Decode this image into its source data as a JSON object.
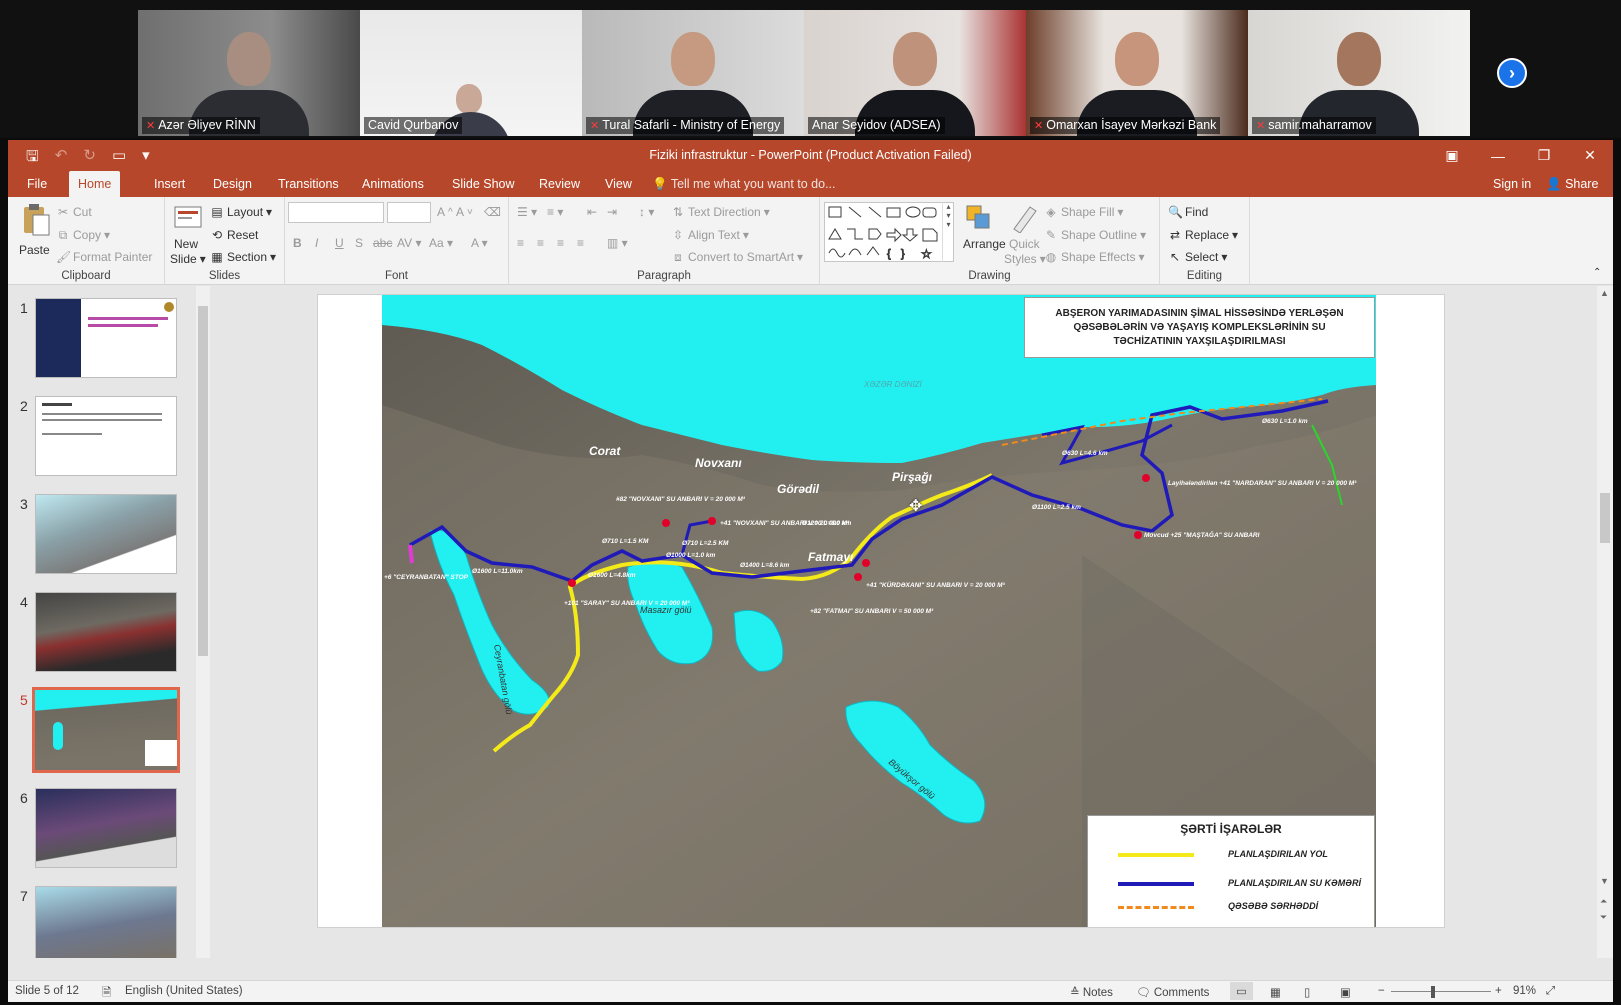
{
  "meeting": {
    "participants": [
      {
        "name": "Azər Əliyev RİNN",
        "muted": true
      },
      {
        "name": "Cavid Qurbanov",
        "muted": false
      },
      {
        "name": "Tural Safarli - Ministry of Energy",
        "muted": true
      },
      {
        "name": "Anar Seyidov (ADSEA)",
        "muted": false,
        "active_speaker": true
      },
      {
        "name": "Omarxan İsayev Mərkəzi Bank",
        "muted": true
      },
      {
        "name": "samir.maharramov",
        "muted": true
      }
    ],
    "next_icon": "chevron-right-icon",
    "accent_color": "#3ee36b"
  },
  "app": {
    "title": "Fiziki infrastruktur - PowerPoint (Product Activation Failed)",
    "accent_color": "#b7472a"
  },
  "tabs": [
    "File",
    "Home",
    "Insert",
    "Design",
    "Transitions",
    "Animations",
    "Slide Show",
    "Review",
    "View"
  ],
  "active_tab": "Home",
  "tell_me": "Tell me what you want to do...",
  "sign_in": "Sign in",
  "share": "Share",
  "ribbon": {
    "clipboard": {
      "label": "Clipboard",
      "paste": "Paste",
      "cut": "Cut",
      "copy": "Copy",
      "format_painter": "Format Painter"
    },
    "slides": {
      "label": "Slides",
      "new_slide_1": "New",
      "new_slide_2": "Slide",
      "layout": "Layout",
      "reset": "Reset",
      "section": "Section"
    },
    "font": {
      "label": "Font"
    },
    "paragraph": {
      "label": "Paragraph",
      "text_direction": "Text Direction",
      "align_text": "Align Text",
      "convert_smartart": "Convert to SmartArt"
    },
    "drawing": {
      "label": "Drawing",
      "arrange": "Arrange",
      "quick_styles_1": "Quick",
      "quick_styles_2": "Styles",
      "shape_fill": "Shape Fill",
      "shape_outline": "Shape Outline",
      "shape_effects": "Shape Effects"
    },
    "editing": {
      "label": "Editing",
      "find": "Find",
      "replace": "Replace",
      "select": "Select"
    }
  },
  "thumbnails": [
    {
      "number": "1"
    },
    {
      "number": "2"
    },
    {
      "number": "3"
    },
    {
      "number": "4"
    },
    {
      "number": "5",
      "selected": true
    },
    {
      "number": "6"
    },
    {
      "number": "7"
    }
  ],
  "slide": {
    "title_box": "ABŞERON YARIMADASININ ŞİMAL HİSSƏSİNDƏ YERLƏŞƏN QƏSƏBƏLƏRİN VƏ YAŞAYIŞ KOMPLEKSLƏRİNİN SU TƏCHİZATININ YAXŞILAŞDIRILMASI",
    "places": {
      "corat": "Corat",
      "novxani": "Novxanı",
      "goradil": "Görədil",
      "pirsagi": "Pirşağı",
      "fatmayi": "Fatmayı",
      "masazir": "Masazır gölü",
      "ceyranbatan": "Ceyranbatan gölü",
      "boyuksor": "Böyükşor gölü",
      "sea": "XƏZƏR DƏNİZİ"
    },
    "labels": {
      "reservoir_novxani_82": "#82 \"NOVXANI\" SU ANBARI V = 20 000 M³",
      "reservoir_novxani_41": "+41 \"NOVXANI\" SU ANBARI V = 20 000 M³",
      "reservoir_saray": "+101 \"SARAY\" SU ANBARI V = 20 000 M³",
      "ceyranbatan_stop": "+6 \"CEYRANBATAN\" STOP",
      "reservoir_kurdaxani": "+41 \"KÜRDƏXANI\" SU ANBARI V = 20 000 M³",
      "reservoir_fatmai": "+82 \"FATMAI\" SU ANBARI V = 50 000 M³",
      "reservoir_nardaran": "Layihələndirilən +41 \"NARDARAN\" SU ANBARI V = 20 000 M³",
      "reservoir_mastaga": "Mövcud +25 \"MAŞTAĞA\" SU ANBARI",
      "pipe_1": "Ø1600 L=11.0km",
      "pipe_2": "Ø1600 L=4.8km",
      "pipe_3": "Ø710 L=1.5 KM",
      "pipe_4": "Ø710 L=2.5 KM",
      "pipe_5": "Ø1000 L=1.0 km",
      "pipe_6": "Ø1400 L=8.6 km",
      "pipe_7": "Ø1200 L=6.0 km",
      "pipe_8": "Ø1100 L=2.5 km",
      "pipe_9": "Ø630 L=4.6 km",
      "pipe_10": "Ø630 L=1.0 km"
    },
    "legend": {
      "title": "ŞƏRTİ İŞARƏLƏR",
      "items": [
        {
          "label": "PLANLAŞDIRILAN YOL",
          "color": "#f4ea1a",
          "style": "solid"
        },
        {
          "label": "PLANLAŞDIRILAN SU KƏMƏRİ",
          "color": "#1f1ab8",
          "style": "solid"
        },
        {
          "label": "QƏSƏBƏ SƏRHƏDDİ",
          "color": "#f08a1c",
          "style": "dashed"
        }
      ]
    }
  },
  "status": {
    "slide_of": "Slide 5 of 12",
    "language": "English (United States)",
    "notes": "Notes",
    "comments": "Comments",
    "zoom": "91%"
  }
}
